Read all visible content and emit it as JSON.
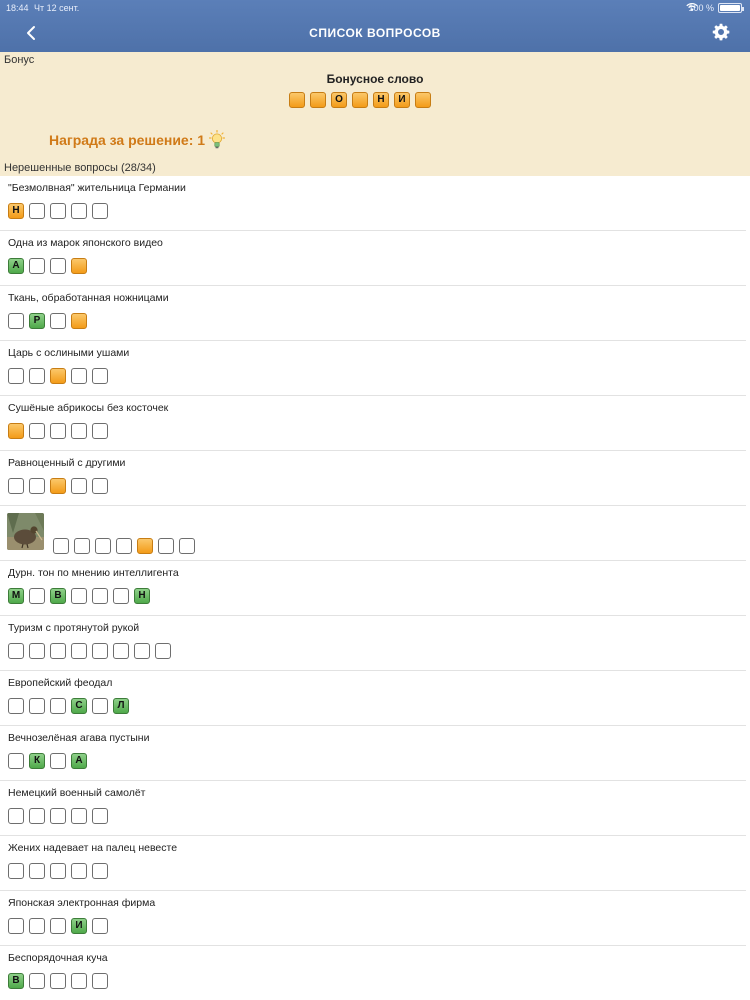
{
  "status_bar": {
    "time": "18:44",
    "date": "Чт 12 сент.",
    "battery": "100 %"
  },
  "nav": {
    "title": "СПИСОК ВОПРОСОВ",
    "back_icon": "chevron-left-icon",
    "settings_icon": "gear-icon"
  },
  "colors": {
    "nav_bar": "#5478b0",
    "bonus_bg": "#f6ebd0",
    "reward_text": "#d07a18",
    "cell_orange": "#f5a623",
    "cell_green": "#5cb85c"
  },
  "bonus": {
    "header": "Бонус",
    "title": "Бонусное слово",
    "cells": [
      {
        "letter": "",
        "state": "orange"
      },
      {
        "letter": "",
        "state": "orange"
      },
      {
        "letter": "О",
        "state": "orange"
      },
      {
        "letter": "",
        "state": "orange"
      },
      {
        "letter": "Н",
        "state": "orange"
      },
      {
        "letter": "И",
        "state": "orange"
      },
      {
        "letter": "",
        "state": "orange"
      }
    ],
    "reward_label": "Награда за решение: 1",
    "reward_icon": "lightbulb-icon"
  },
  "unsolved_header": "Нерешенные вопросы (28/34)",
  "questions": [
    {
      "text": "\"Безмолвная\" жительница Германии",
      "cells": [
        {
          "letter": "Н",
          "state": "orange"
        },
        {
          "letter": "",
          "state": "empty"
        },
        {
          "letter": "",
          "state": "empty"
        },
        {
          "letter": "",
          "state": "empty"
        },
        {
          "letter": "",
          "state": "empty"
        }
      ]
    },
    {
      "text": "Одна из марок японского видео",
      "cells": [
        {
          "letter": "А",
          "state": "green"
        },
        {
          "letter": "",
          "state": "empty"
        },
        {
          "letter": "",
          "state": "empty"
        },
        {
          "letter": "",
          "state": "orange"
        }
      ]
    },
    {
      "text": "Ткань, обработанная ножницами",
      "cells": [
        {
          "letter": "",
          "state": "empty"
        },
        {
          "letter": "Р",
          "state": "green"
        },
        {
          "letter": "",
          "state": "empty"
        },
        {
          "letter": "",
          "state": "orange"
        }
      ]
    },
    {
      "text": "Царь с ослиными ушами",
      "cells": [
        {
          "letter": "",
          "state": "empty"
        },
        {
          "letter": "",
          "state": "empty"
        },
        {
          "letter": "",
          "state": "orange"
        },
        {
          "letter": "",
          "state": "empty"
        },
        {
          "letter": "",
          "state": "empty"
        }
      ]
    },
    {
      "text": "Сушёные абрикосы без косточек",
      "cells": [
        {
          "letter": "",
          "state": "orange"
        },
        {
          "letter": "",
          "state": "empty"
        },
        {
          "letter": "",
          "state": "empty"
        },
        {
          "letter": "",
          "state": "empty"
        },
        {
          "letter": "",
          "state": "empty"
        }
      ]
    },
    {
      "text": "Равноценный с другими",
      "cells": [
        {
          "letter": "",
          "state": "empty"
        },
        {
          "letter": "",
          "state": "empty"
        },
        {
          "letter": "",
          "state": "orange"
        },
        {
          "letter": "",
          "state": "empty"
        },
        {
          "letter": "",
          "state": "empty"
        }
      ]
    },
    {
      "text": "",
      "image": "kiwi-bird-photo",
      "cells": [
        {
          "letter": "",
          "state": "empty"
        },
        {
          "letter": "",
          "state": "empty"
        },
        {
          "letter": "",
          "state": "empty"
        },
        {
          "letter": "",
          "state": "empty"
        },
        {
          "letter": "",
          "state": "orange"
        },
        {
          "letter": "",
          "state": "empty"
        },
        {
          "letter": "",
          "state": "empty"
        }
      ]
    },
    {
      "text": "Дурн. тон по мнению интеллигента",
      "cells": [
        {
          "letter": "М",
          "state": "green"
        },
        {
          "letter": "",
          "state": "empty"
        },
        {
          "letter": "В",
          "state": "green"
        },
        {
          "letter": "",
          "state": "empty"
        },
        {
          "letter": "",
          "state": "empty"
        },
        {
          "letter": "",
          "state": "empty"
        },
        {
          "letter": "Н",
          "state": "green"
        }
      ]
    },
    {
      "text": "Туризм с протянутой рукой",
      "cells": [
        {
          "letter": "",
          "state": "empty"
        },
        {
          "letter": "",
          "state": "empty"
        },
        {
          "letter": "",
          "state": "empty"
        },
        {
          "letter": "",
          "state": "empty"
        },
        {
          "letter": "",
          "state": "empty"
        },
        {
          "letter": "",
          "state": "empty"
        },
        {
          "letter": "",
          "state": "empty"
        },
        {
          "letter": "",
          "state": "empty"
        }
      ]
    },
    {
      "text": "Европейский феодал",
      "cells": [
        {
          "letter": "",
          "state": "empty"
        },
        {
          "letter": "",
          "state": "empty"
        },
        {
          "letter": "",
          "state": "empty"
        },
        {
          "letter": "С",
          "state": "green"
        },
        {
          "letter": "",
          "state": "empty"
        },
        {
          "letter": "Л",
          "state": "green"
        }
      ]
    },
    {
      "text": "Вечнозелёная агава пустыни",
      "cells": [
        {
          "letter": "",
          "state": "empty"
        },
        {
          "letter": "К",
          "state": "green"
        },
        {
          "letter": "",
          "state": "empty"
        },
        {
          "letter": "А",
          "state": "green"
        }
      ]
    },
    {
      "text": "Немецкий военный самолёт",
      "cells": [
        {
          "letter": "",
          "state": "empty"
        },
        {
          "letter": "",
          "state": "empty"
        },
        {
          "letter": "",
          "state": "empty"
        },
        {
          "letter": "",
          "state": "empty"
        },
        {
          "letter": "",
          "state": "empty"
        }
      ]
    },
    {
      "text": "Жених надевает на палец невесте",
      "cells": [
        {
          "letter": "",
          "state": "empty"
        },
        {
          "letter": "",
          "state": "empty"
        },
        {
          "letter": "",
          "state": "empty"
        },
        {
          "letter": "",
          "state": "empty"
        },
        {
          "letter": "",
          "state": "empty"
        }
      ]
    },
    {
      "text": "Японская электронная фирма",
      "cells": [
        {
          "letter": "",
          "state": "empty"
        },
        {
          "letter": "",
          "state": "empty"
        },
        {
          "letter": "",
          "state": "empty"
        },
        {
          "letter": "И",
          "state": "green"
        },
        {
          "letter": "",
          "state": "empty"
        }
      ]
    },
    {
      "text": "Беспорядочная куча",
      "cells": [
        {
          "letter": "В",
          "state": "green"
        },
        {
          "letter": "",
          "state": "empty"
        },
        {
          "letter": "",
          "state": "empty"
        },
        {
          "letter": "",
          "state": "empty"
        },
        {
          "letter": "",
          "state": "empty"
        }
      ]
    }
  ]
}
